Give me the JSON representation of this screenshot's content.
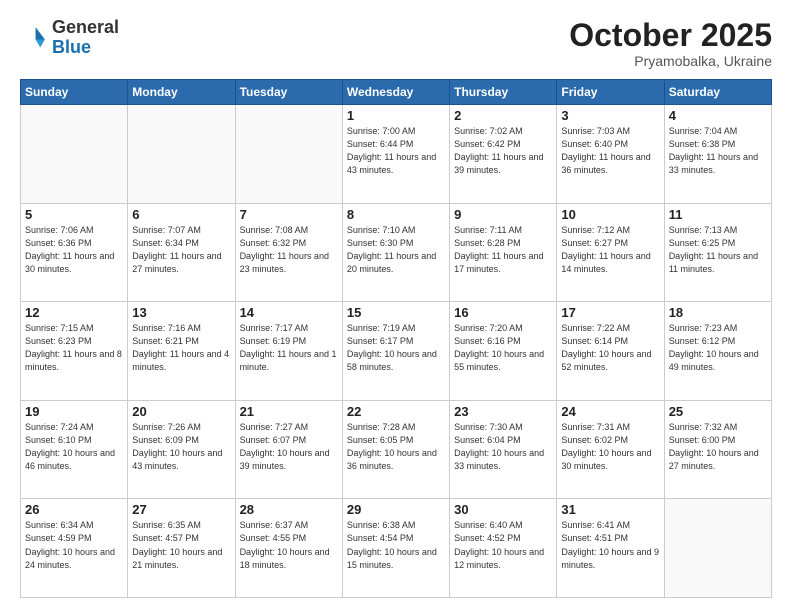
{
  "header": {
    "logo_general": "General",
    "logo_blue": "Blue",
    "month": "October 2025",
    "location": "Pryamobalka, Ukraine"
  },
  "weekdays": [
    "Sunday",
    "Monday",
    "Tuesday",
    "Wednesday",
    "Thursday",
    "Friday",
    "Saturday"
  ],
  "weeks": [
    [
      {
        "day": "",
        "info": ""
      },
      {
        "day": "",
        "info": ""
      },
      {
        "day": "",
        "info": ""
      },
      {
        "day": "1",
        "info": "Sunrise: 7:00 AM\nSunset: 6:44 PM\nDaylight: 11 hours\nand 43 minutes."
      },
      {
        "day": "2",
        "info": "Sunrise: 7:02 AM\nSunset: 6:42 PM\nDaylight: 11 hours\nand 39 minutes."
      },
      {
        "day": "3",
        "info": "Sunrise: 7:03 AM\nSunset: 6:40 PM\nDaylight: 11 hours\nand 36 minutes."
      },
      {
        "day": "4",
        "info": "Sunrise: 7:04 AM\nSunset: 6:38 PM\nDaylight: 11 hours\nand 33 minutes."
      }
    ],
    [
      {
        "day": "5",
        "info": "Sunrise: 7:06 AM\nSunset: 6:36 PM\nDaylight: 11 hours\nand 30 minutes."
      },
      {
        "day": "6",
        "info": "Sunrise: 7:07 AM\nSunset: 6:34 PM\nDaylight: 11 hours\nand 27 minutes."
      },
      {
        "day": "7",
        "info": "Sunrise: 7:08 AM\nSunset: 6:32 PM\nDaylight: 11 hours\nand 23 minutes."
      },
      {
        "day": "8",
        "info": "Sunrise: 7:10 AM\nSunset: 6:30 PM\nDaylight: 11 hours\nand 20 minutes."
      },
      {
        "day": "9",
        "info": "Sunrise: 7:11 AM\nSunset: 6:28 PM\nDaylight: 11 hours\nand 17 minutes."
      },
      {
        "day": "10",
        "info": "Sunrise: 7:12 AM\nSunset: 6:27 PM\nDaylight: 11 hours\nand 14 minutes."
      },
      {
        "day": "11",
        "info": "Sunrise: 7:13 AM\nSunset: 6:25 PM\nDaylight: 11 hours\nand 11 minutes."
      }
    ],
    [
      {
        "day": "12",
        "info": "Sunrise: 7:15 AM\nSunset: 6:23 PM\nDaylight: 11 hours\nand 8 minutes."
      },
      {
        "day": "13",
        "info": "Sunrise: 7:16 AM\nSunset: 6:21 PM\nDaylight: 11 hours\nand 4 minutes."
      },
      {
        "day": "14",
        "info": "Sunrise: 7:17 AM\nSunset: 6:19 PM\nDaylight: 11 hours\nand 1 minute."
      },
      {
        "day": "15",
        "info": "Sunrise: 7:19 AM\nSunset: 6:17 PM\nDaylight: 10 hours\nand 58 minutes."
      },
      {
        "day": "16",
        "info": "Sunrise: 7:20 AM\nSunset: 6:16 PM\nDaylight: 10 hours\nand 55 minutes."
      },
      {
        "day": "17",
        "info": "Sunrise: 7:22 AM\nSunset: 6:14 PM\nDaylight: 10 hours\nand 52 minutes."
      },
      {
        "day": "18",
        "info": "Sunrise: 7:23 AM\nSunset: 6:12 PM\nDaylight: 10 hours\nand 49 minutes."
      }
    ],
    [
      {
        "day": "19",
        "info": "Sunrise: 7:24 AM\nSunset: 6:10 PM\nDaylight: 10 hours\nand 46 minutes."
      },
      {
        "day": "20",
        "info": "Sunrise: 7:26 AM\nSunset: 6:09 PM\nDaylight: 10 hours\nand 43 minutes."
      },
      {
        "day": "21",
        "info": "Sunrise: 7:27 AM\nSunset: 6:07 PM\nDaylight: 10 hours\nand 39 minutes."
      },
      {
        "day": "22",
        "info": "Sunrise: 7:28 AM\nSunset: 6:05 PM\nDaylight: 10 hours\nand 36 minutes."
      },
      {
        "day": "23",
        "info": "Sunrise: 7:30 AM\nSunset: 6:04 PM\nDaylight: 10 hours\nand 33 minutes."
      },
      {
        "day": "24",
        "info": "Sunrise: 7:31 AM\nSunset: 6:02 PM\nDaylight: 10 hours\nand 30 minutes."
      },
      {
        "day": "25",
        "info": "Sunrise: 7:32 AM\nSunset: 6:00 PM\nDaylight: 10 hours\nand 27 minutes."
      }
    ],
    [
      {
        "day": "26",
        "info": "Sunrise: 6:34 AM\nSunset: 4:59 PM\nDaylight: 10 hours\nand 24 minutes."
      },
      {
        "day": "27",
        "info": "Sunrise: 6:35 AM\nSunset: 4:57 PM\nDaylight: 10 hours\nand 21 minutes."
      },
      {
        "day": "28",
        "info": "Sunrise: 6:37 AM\nSunset: 4:55 PM\nDaylight: 10 hours\nand 18 minutes."
      },
      {
        "day": "29",
        "info": "Sunrise: 6:38 AM\nSunset: 4:54 PM\nDaylight: 10 hours\nand 15 minutes."
      },
      {
        "day": "30",
        "info": "Sunrise: 6:40 AM\nSunset: 4:52 PM\nDaylight: 10 hours\nand 12 minutes."
      },
      {
        "day": "31",
        "info": "Sunrise: 6:41 AM\nSunset: 4:51 PM\nDaylight: 10 hours\nand 9 minutes."
      },
      {
        "day": "",
        "info": ""
      }
    ]
  ]
}
